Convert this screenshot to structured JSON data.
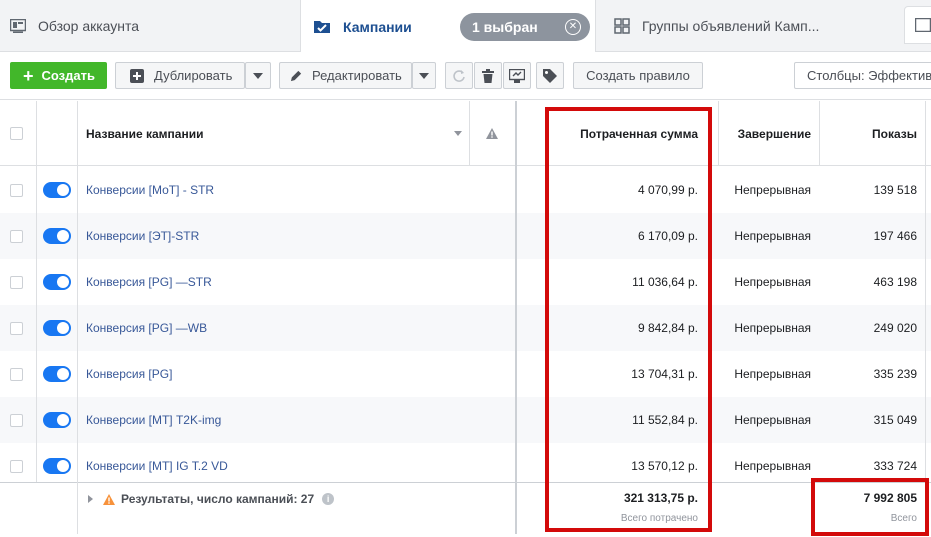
{
  "tabs": {
    "overview": "Обзор аккаунта",
    "campaigns": "Кампании",
    "selected_chip": "1 выбран",
    "groups": "Группы объявлений Камп..."
  },
  "toolbar": {
    "create": "Создать",
    "duplicate": "Дублировать",
    "edit": "Редактировать",
    "create_rule": "Создать правило",
    "columns": "Столбцы: Эффектив"
  },
  "table": {
    "headers": {
      "name": "Название кампании",
      "spent": "Потраченная сумма",
      "end": "Завершение",
      "impressions": "Показы"
    },
    "rows": [
      {
        "name": "Конверсии [МоТ] - STR",
        "spent": "4 070,99 р.",
        "end": "Непрерывная",
        "impressions": "139 518"
      },
      {
        "name": "Конверсии [ЭТ]-STR",
        "spent": "6 170,09 р.",
        "end": "Непрерывная",
        "impressions": "197 466"
      },
      {
        "name": "Конверсия [PG] —STR",
        "spent": "11 036,64 р.",
        "end": "Непрерывная",
        "impressions": "463 198"
      },
      {
        "name": "Конверсия [PG] —WB",
        "spent": "9 842,84 р.",
        "end": "Непрерывная",
        "impressions": "249 020"
      },
      {
        "name": "Конверсия [PG]",
        "spent": "13 704,31 р.",
        "end": "Непрерывная",
        "impressions": "335 239"
      },
      {
        "name": "Конверсии [МТ] T2K-img",
        "spent": "11 552,84 р.",
        "end": "Непрерывная",
        "impressions": "315 049"
      },
      {
        "name": "Конверсии [МТ] IG T.2 VD",
        "spent": "13 570,12 р.",
        "end": "Непрерывная",
        "impressions": "333 724"
      }
    ],
    "summary": {
      "label": "Результаты, число кампаний: 27",
      "spent_total": "321 313,75 р.",
      "spent_caption": "Всего потрачено",
      "impressions_total": "7 992 805",
      "impressions_caption": "Всего"
    }
  },
  "colors": {
    "accent": "#1877f2",
    "create_green": "#42b72a",
    "highlight_red": "#d30a0a",
    "link": "#385898"
  }
}
